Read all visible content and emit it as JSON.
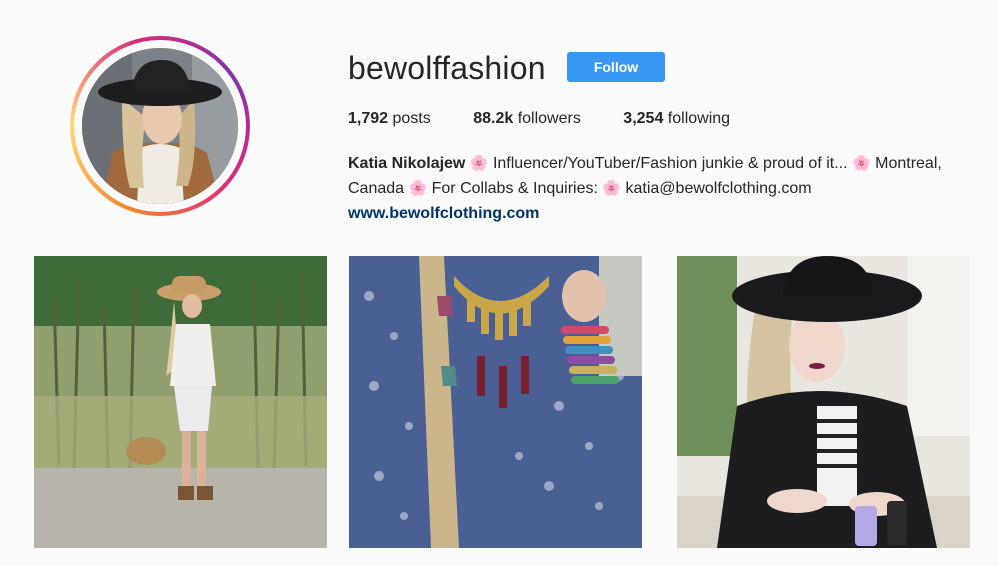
{
  "profile": {
    "username": "bewolffashion",
    "follow_label": "Follow",
    "stats": {
      "posts_count": "1,792",
      "posts_label": "posts",
      "followers_count": "88.2k",
      "followers_label": "followers",
      "following_count": "3,254",
      "following_label": "following"
    },
    "bio": {
      "full_name": "Katia Nikolajew",
      "flower_emoji": "🌸",
      "line_part_1": " Influencer/YouTuber/Fashion junkie & proud of it... ",
      "line_part_2": " Montreal, Canada ",
      "line_part_3": " For Collabs & Inquiries: ",
      "line_part_4": " katia@bewolfclothing.com"
    },
    "website": "www.bewolfclothing.com"
  },
  "colors": {
    "follow_button": "#3897f0",
    "website_link": "#003569",
    "story_ring": [
      "#f58529",
      "#dd2a7b",
      "#8134af"
    ],
    "flower": "#e9559b"
  },
  "posts": [
    {
      "subject": "woman in white romper and straw hat standing in tall grass"
    },
    {
      "subject": "close-up of gold statement necklace, braided hair and beaded bracelets"
    },
    {
      "subject": "woman in black hat and leather jacket painting nails at a table"
    }
  ]
}
